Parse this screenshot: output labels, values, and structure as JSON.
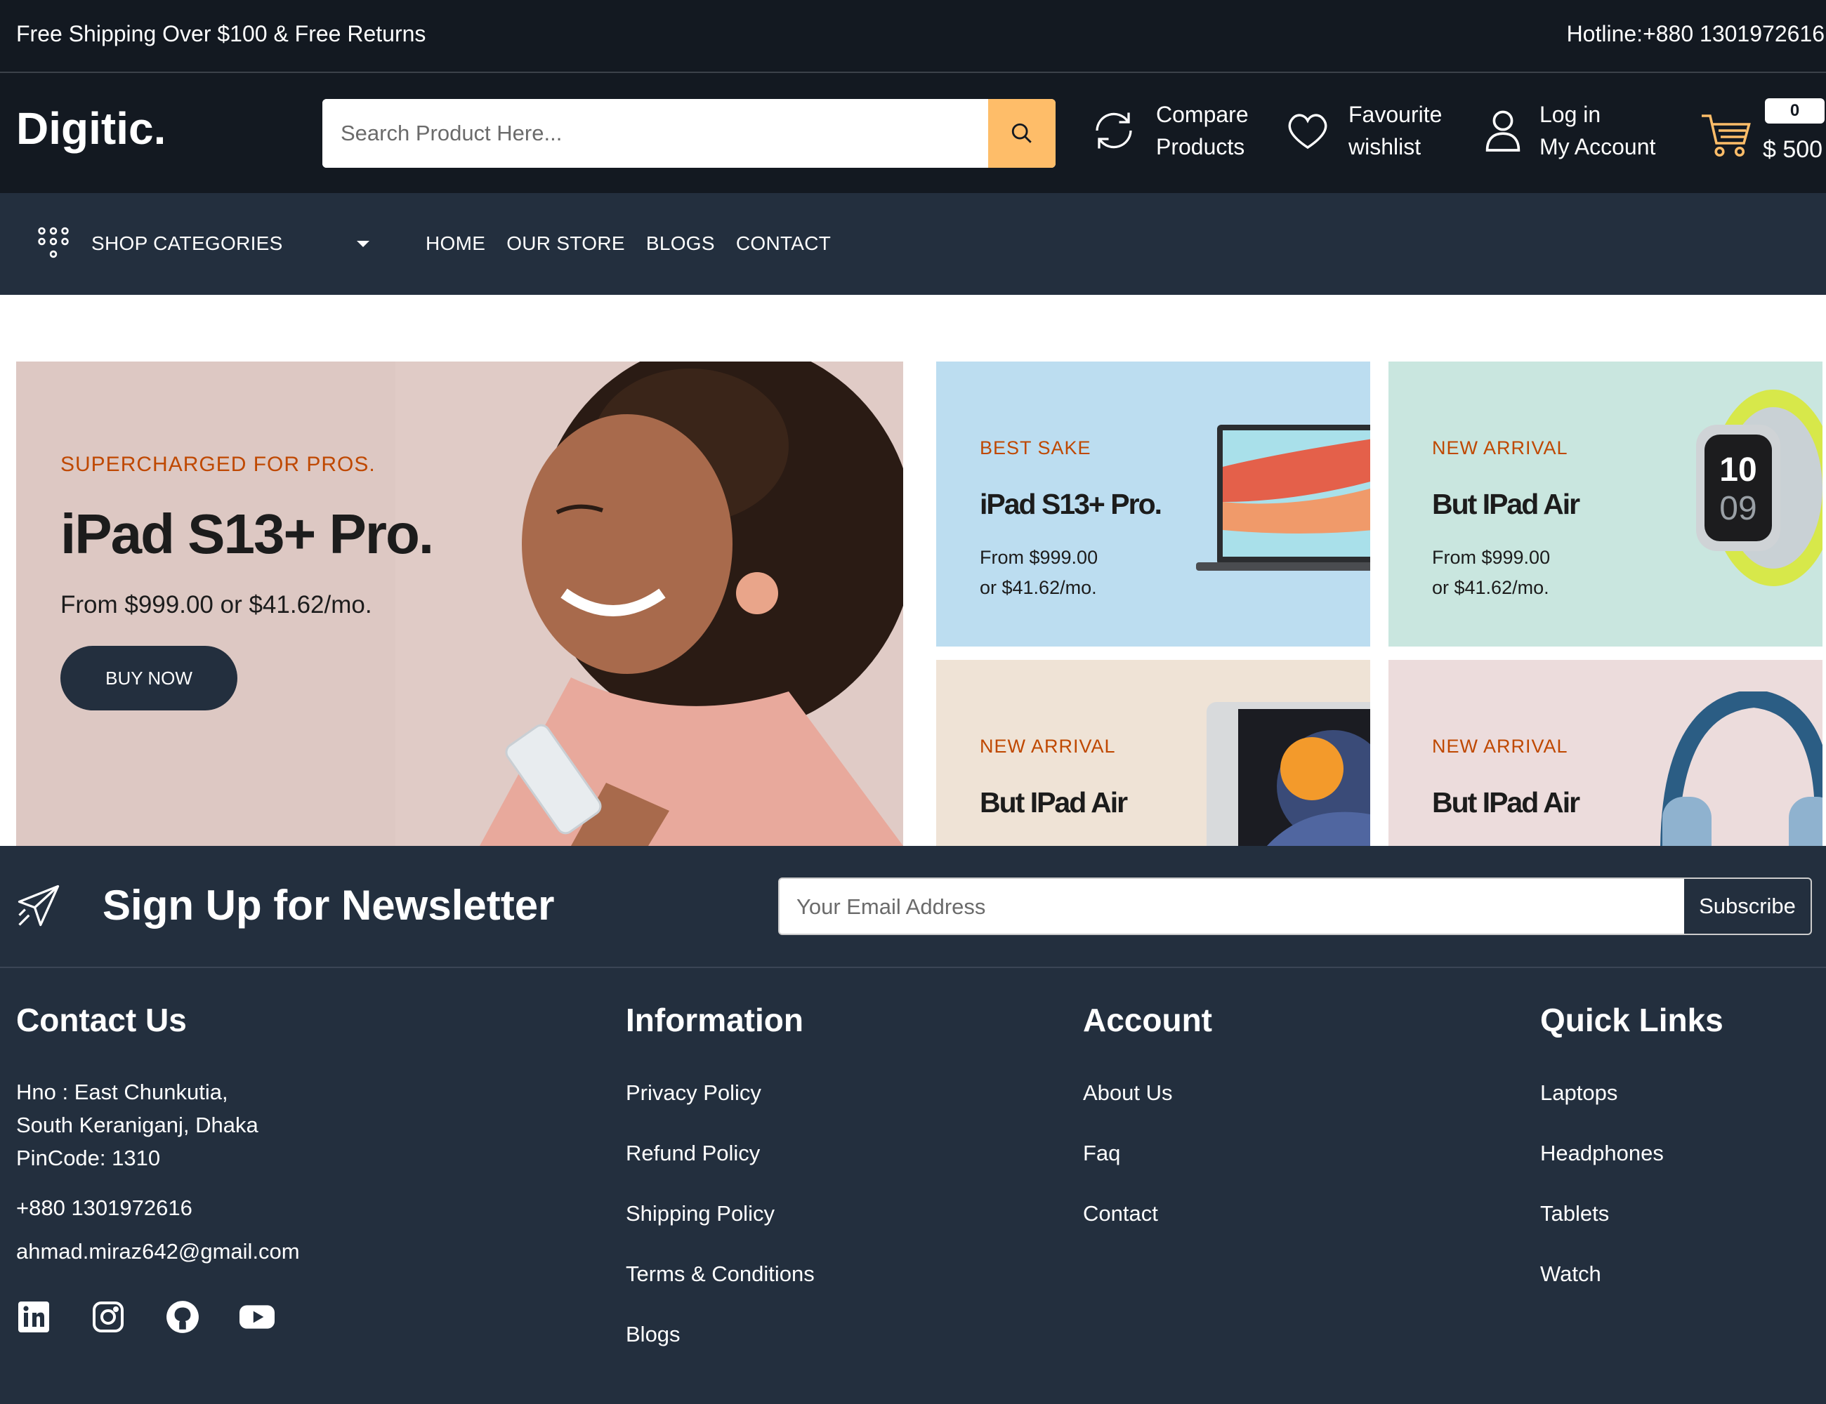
{
  "topbar": {
    "promo": "Free Shipping Over $100 & Free Returns",
    "hotline": "Hotline:+880 1301972616"
  },
  "header": {
    "logo": "Digitic.",
    "search_placeholder": "Search Product Here...",
    "compare_line1": "Compare",
    "compare_line2": "Products",
    "wishlist_line1": "Favourite",
    "wishlist_line2": "wishlist",
    "account_line1": "Log in",
    "account_line2": "My Account",
    "cart_count": "0",
    "cart_total": "$ 500"
  },
  "nav": {
    "categories_label": "SHOP CATEGORIES",
    "links": [
      "HOME",
      "OUR STORE",
      "BLOGS",
      "CONTACT"
    ]
  },
  "hero": {
    "kicker": "SUPERCHARGED FOR PROS.",
    "title": "iPad S13+ Pro.",
    "price": "From $999.00 or $41.62/mo.",
    "button": "BUY NOW"
  },
  "tiles": [
    {
      "kicker": "BEST SAKE",
      "title": "iPad S13+ Pro.",
      "price_line1": "From $999.00",
      "price_line2": "or $41.62/mo.",
      "bg": "#bcddf0"
    },
    {
      "kicker": "NEW ARRIVAL",
      "title": "But IPad Air",
      "price_line1": "From $999.00",
      "price_line2": "or $41.62/mo.",
      "bg": "#c9e6df"
    },
    {
      "kicker": "NEW ARRIVAL",
      "title": "But IPad Air",
      "bg": "#efe3d6"
    },
    {
      "kicker": "NEW ARRIVAL",
      "title": "But IPad Air",
      "bg": "#ecdcdc"
    }
  ],
  "newsletter": {
    "title": "Sign Up for Newsletter",
    "placeholder": "Your Email Address",
    "button": "Subscribe"
  },
  "footer": {
    "contact": {
      "heading": "Contact Us",
      "address_line1": "Hno : East Chunkutia,",
      "address_line2": "South Keraniganj, Dhaka",
      "address_line3": "PinCode: 1310",
      "phone": "+880 1301972616",
      "email": "ahmad.miraz642@gmail.com"
    },
    "information": {
      "heading": "Information",
      "links": [
        "Privacy Policy",
        "Refund Policy",
        "Shipping Policy",
        "Terms & Conditions",
        "Blogs"
      ]
    },
    "account": {
      "heading": "Account",
      "links": [
        "About Us",
        "Faq",
        "Contact"
      ]
    },
    "quick_links": {
      "heading": "Quick Links",
      "links": [
        "Laptops",
        "Headphones",
        "Tablets",
        "Watch"
      ]
    },
    "socials": [
      "linkedin-icon",
      "instagram-icon",
      "github-icon",
      "youtube-icon"
    ]
  },
  "colors": {
    "dark": "#131921",
    "navy": "#232f3e",
    "accent": "#febd69",
    "kicker": "#bf4800"
  }
}
